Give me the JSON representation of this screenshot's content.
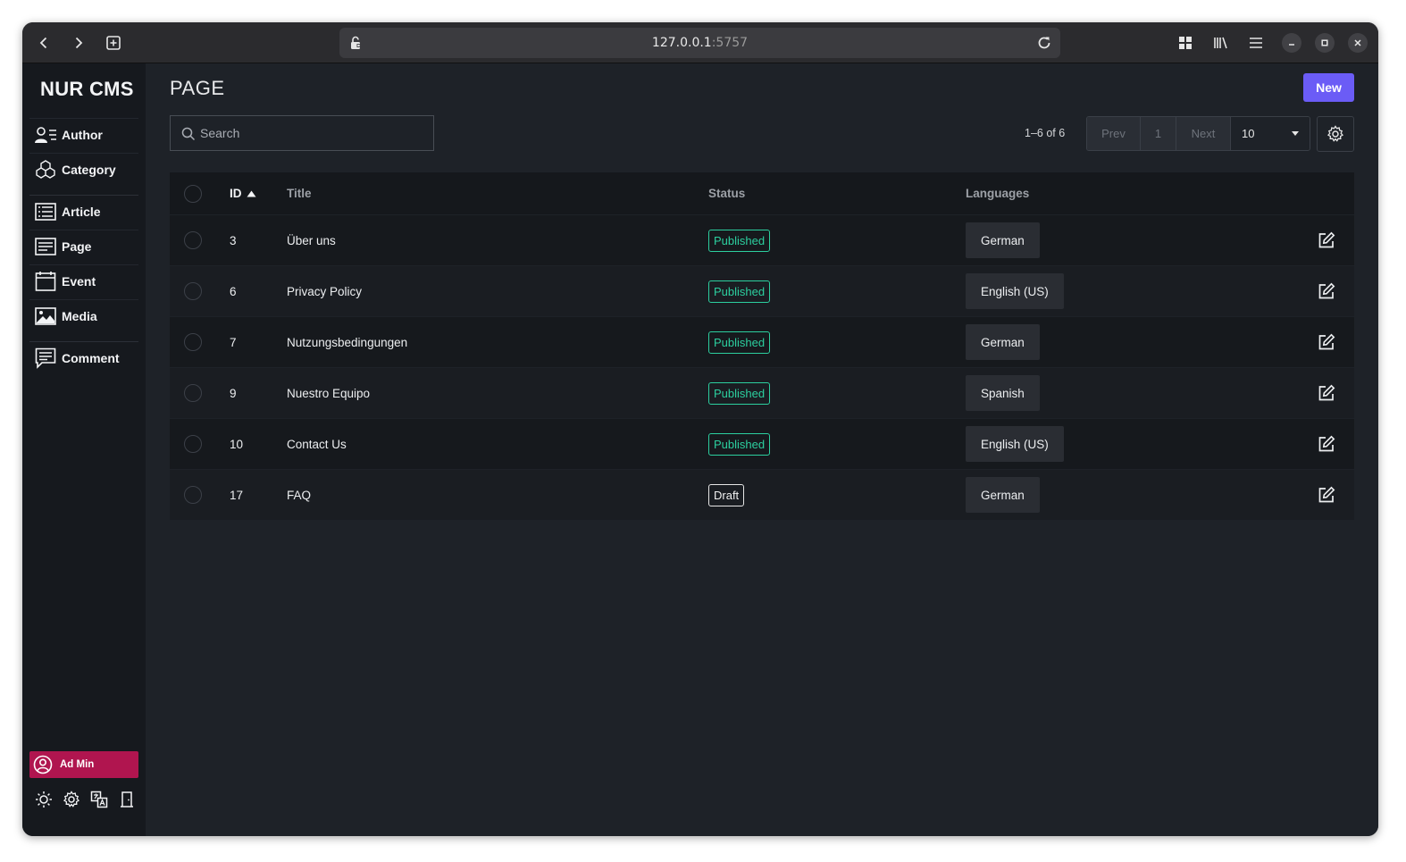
{
  "browser": {
    "url_host": "127.0.0.1",
    "url_port": ":5757"
  },
  "sidebar": {
    "brand": "NUR CMS",
    "items": [
      {
        "label": "Author",
        "icon": "author-icon"
      },
      {
        "label": "Category",
        "icon": "category-icon"
      },
      {
        "label": "Article",
        "icon": "article-icon"
      },
      {
        "label": "Page",
        "icon": "page-icon"
      },
      {
        "label": "Event",
        "icon": "event-icon"
      },
      {
        "label": "Media",
        "icon": "media-icon"
      },
      {
        "label": "Comment",
        "icon": "comment-icon"
      }
    ],
    "user": {
      "name": "Ad Min"
    },
    "accent_color": "#b0154f"
  },
  "main": {
    "title": "PAGE",
    "new_label": "New",
    "new_color": "#6b5cf6",
    "search_placeholder": "Search",
    "count_text": "1–6 of 6",
    "pager": {
      "prev": "Prev",
      "page": "1",
      "next": "Next",
      "per_page": "10"
    }
  },
  "table": {
    "headers": {
      "id": "ID",
      "title": "Title",
      "status": "Status",
      "languages": "Languages"
    },
    "sort": {
      "column": "ID",
      "direction": "ascending"
    },
    "status_colors": {
      "Published": "#2ccf9f",
      "Draft": "#e6e6e6"
    },
    "rows": [
      {
        "id": "3",
        "title": "Über uns",
        "status": "Published",
        "language": "German"
      },
      {
        "id": "6",
        "title": "Privacy Policy",
        "status": "Published",
        "language": "English (US)"
      },
      {
        "id": "7",
        "title": "Nutzungsbedingungen",
        "status": "Published",
        "language": "German"
      },
      {
        "id": "9",
        "title": "Nuestro Equipo",
        "status": "Published",
        "language": "Spanish"
      },
      {
        "id": "10",
        "title": "Contact Us",
        "status": "Published",
        "language": "English (US)"
      },
      {
        "id": "17",
        "title": "FAQ",
        "status": "Draft",
        "language": "German"
      }
    ]
  }
}
